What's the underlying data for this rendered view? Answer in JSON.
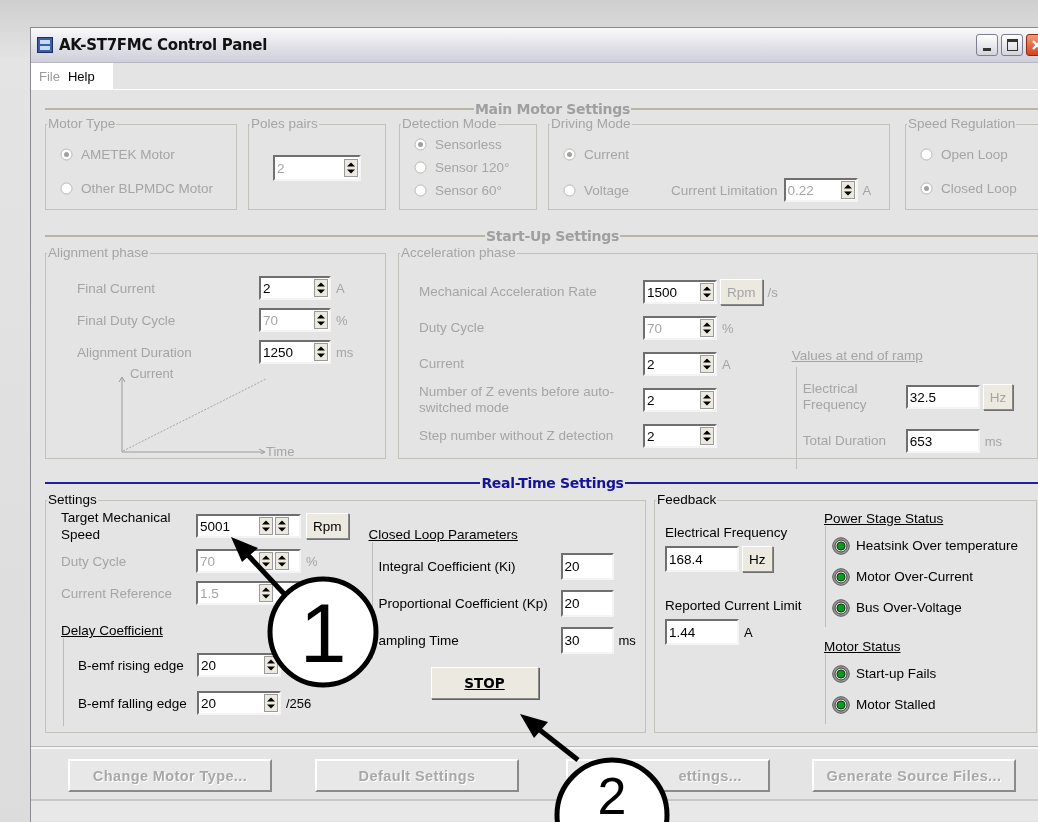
{
  "window": {
    "title": "AK-ST7FMC Control Panel"
  },
  "menu": [
    {
      "label": "File",
      "disabled": true
    },
    {
      "label": "Help",
      "disabled": false
    }
  ],
  "main_motor_settings": {
    "title": "Main Motor Settings",
    "disabled": true,
    "motor_type": {
      "title": "Motor Type",
      "options": [
        {
          "label": "AMETEK Motor",
          "selected": true
        },
        {
          "label": "Other BLPMDC Motor",
          "selected": false
        }
      ]
    },
    "poles_pairs": {
      "title": "Poles pairs",
      "value": "2"
    },
    "detection_mode": {
      "title": "Detection Mode",
      "options": [
        {
          "label": "Sensorless",
          "selected": true
        },
        {
          "label": "Sensor 120°",
          "selected": false
        },
        {
          "label": "Sensor 60°",
          "selected": false
        }
      ]
    },
    "driving_mode": {
      "title": "Driving Mode",
      "options": [
        {
          "label": "Current",
          "selected": true
        },
        {
          "label": "Voltage",
          "selected": false
        }
      ],
      "current_limitation": {
        "label": "Current Limitation",
        "value": "0.22",
        "unit": "A"
      }
    },
    "speed_regulation": {
      "title": "Speed Regulation",
      "options": [
        {
          "label": "Open Loop",
          "selected": false
        },
        {
          "label": "Closed Loop",
          "selected": true
        }
      ]
    }
  },
  "start_up_settings": {
    "title": "Start-Up Settings",
    "disabled": true,
    "alignment_phase": {
      "title": "Alignment phase",
      "fields": [
        {
          "label": "Final Current",
          "value": "2",
          "unit": "A",
          "kind": "spin",
          "disabled": false
        },
        {
          "label": "Final Duty Cycle",
          "value": "70",
          "unit": "%",
          "kind": "spin",
          "disabled": true
        },
        {
          "label": "Alignment Duration",
          "value": "1250",
          "unit": "ms",
          "kind": "spin",
          "disabled": false
        }
      ],
      "graph": {
        "y_label": "Current",
        "x_label": "Time"
      }
    },
    "acceleration_phase": {
      "title": "Acceleration phase",
      "fields": [
        {
          "label": "Mechanical Acceleration Rate",
          "value": "1500",
          "unit_button": "Rpm",
          "unit": "/s",
          "kind": "spin",
          "disabled": false
        },
        {
          "label": "Duty Cycle",
          "value": "70",
          "unit": "%",
          "kind": "spin",
          "disabled": true
        },
        {
          "label": "Current",
          "value": "2",
          "unit": "A",
          "kind": "spin",
          "disabled": false
        },
        {
          "label": "Number of Z events before auto-switched mode",
          "value": "2",
          "kind": "spin",
          "disabled": false
        },
        {
          "label": "Step number without Z detection",
          "value": "2",
          "kind": "spin",
          "disabled": false
        }
      ],
      "end_of_ramp": {
        "title": "Values at end of ramp",
        "fields": [
          {
            "label": "Electrical Frequency",
            "value": "32.5",
            "unit_button": "Hz",
            "disabled": false
          },
          {
            "label": "Total Duration",
            "value": "653",
            "unit": "ms",
            "disabled": false
          }
        ]
      }
    }
  },
  "real_time_settings": {
    "title": "Real-Time Settings",
    "settings": {
      "title": "Settings",
      "fields": [
        {
          "label": "Target Mechanical Speed",
          "value": "5001",
          "unit_button": "Rpm",
          "kind": "double_spin",
          "disabled": false
        },
        {
          "label": "Duty Cycle",
          "value": "70",
          "unit": "%",
          "kind": "double_spin",
          "disabled": true
        },
        {
          "label": "Current Reference",
          "value": "1.5",
          "kind": "spin",
          "disabled": true
        }
      ],
      "delay_coefficient": {
        "title": "Delay Coefficient",
        "fields": [
          {
            "label": "B-emf rising edge",
            "value": "20",
            "kind": "spin",
            "disabled": false
          },
          {
            "label": "B-emf falling edge",
            "value": "20",
            "unit": "/256",
            "kind": "spin",
            "disabled": false
          }
        ]
      },
      "closed_loop_parameters": {
        "title": "Closed Loop Parameters",
        "fields": [
          {
            "label": "Integral Coefficient (Ki)",
            "value": "20",
            "disabled": false
          },
          {
            "label": "Proportional Coefficient (Kp)",
            "value": "20",
            "disabled": false
          },
          {
            "label": "ampling Time",
            "value": "30",
            "unit": "ms",
            "disabled": false
          }
        ]
      },
      "stop_button": "STOP"
    },
    "feedback": {
      "title": "Feedback",
      "electrical_frequency": {
        "label": "Electrical Frequency",
        "value": "168.4",
        "unit_button": "Hz"
      },
      "reported_current_limit": {
        "label": "Reported Current Limit",
        "value": "1.44",
        "unit": "A"
      },
      "power_stage_status": {
        "title": "Power Stage Status",
        "items": [
          {
            "label": "Heatsink Over temperature",
            "on": true
          },
          {
            "label": "Motor Over-Current",
            "on": true
          },
          {
            "label": "Bus Over-Voltage",
            "on": true
          }
        ]
      },
      "motor_status": {
        "title": "Motor Status",
        "items": [
          {
            "label": "Start-up Fails",
            "on": true
          },
          {
            "label": "Motor Stalled",
            "on": true
          }
        ]
      }
    }
  },
  "buttons": [
    {
      "label": "Change Motor Type...",
      "disabled": true
    },
    {
      "label": "Default Settings",
      "disabled": true
    },
    {
      "label": "ettings...",
      "disabled": true
    },
    {
      "label": "Generate Source Files...",
      "disabled": true
    }
  ],
  "callouts": [
    {
      "number": "1"
    },
    {
      "number": "2"
    }
  ]
}
